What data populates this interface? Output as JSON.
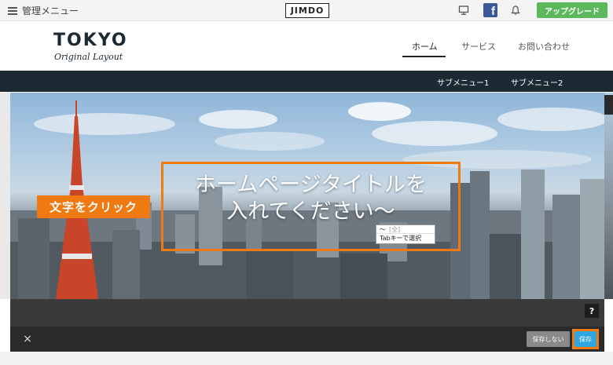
{
  "adminbar": {
    "menu_label": "管理メニュー",
    "logo": "JIMDO",
    "monitor_icon": "monitor-icon",
    "facebook_icon": "facebook-icon",
    "facebook_glyph": "f",
    "bell_icon": "bell-icon",
    "upgrade_label": "アップグレード",
    "upgrade_color": "#5cb85c"
  },
  "site": {
    "logo_main": "TOKYO",
    "logo_sub": "Original Layout",
    "nav": [
      "ホーム",
      "サービス",
      "お問い合わせ"
    ],
    "active_nav": "ホーム",
    "subnav": [
      "サブメニュー1",
      "サブメニュー2"
    ],
    "header_dark_color": "#1c2a33"
  },
  "hero": {
    "click_tag": "文字をクリック",
    "title_line1": "ホームページタイトルを",
    "title_line2": "入れてください〜",
    "accent_color": "#ef7a12",
    "ime": {
      "candidate": "〜",
      "candidate_hint": "[全]",
      "tab_hint": "Tabキーで選択"
    }
  },
  "editor": {
    "help_label": "?",
    "close_label": "×",
    "nosave_label": "保存しない",
    "save_label": "保存",
    "save_color": "#2ea7e0"
  }
}
